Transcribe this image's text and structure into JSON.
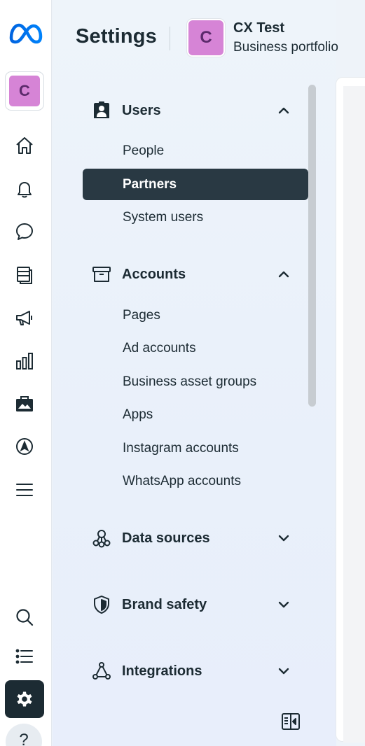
{
  "rail": {
    "items": [
      {
        "name": "home-icon"
      },
      {
        "name": "bell-icon"
      },
      {
        "name": "chat-icon"
      },
      {
        "name": "content-icon"
      },
      {
        "name": "megaphone-icon"
      },
      {
        "name": "chart-icon"
      },
      {
        "name": "briefcase-icon"
      },
      {
        "name": "compass-icon"
      },
      {
        "name": "menu-icon"
      },
      {
        "name": "search-icon"
      },
      {
        "name": "list-icon"
      },
      {
        "name": "gear-icon"
      },
      {
        "name": "help-icon"
      }
    ],
    "avatar_letter": "C",
    "help_glyph": "?"
  },
  "header": {
    "title": "Settings",
    "business_avatar_letter": "C",
    "business_name": "CX Test",
    "business_subtitle": "Business portfolio"
  },
  "nav": {
    "users": {
      "label": "Users",
      "items": [
        "People",
        "Partners",
        "System users"
      ],
      "selected": "Partners"
    },
    "accounts": {
      "label": "Accounts",
      "items": [
        "Pages",
        "Ad accounts",
        "Business asset groups",
        "Apps",
        "Instagram accounts",
        "WhatsApp accounts"
      ]
    },
    "data_sources": {
      "label": "Data sources"
    },
    "brand_safety": {
      "label": "Brand safety"
    },
    "integrations": {
      "label": "Integrations"
    }
  },
  "colors": {
    "accent_dark": "#293943",
    "avatar_purple": "#d684d6",
    "meta_blue": "#0866ff"
  }
}
